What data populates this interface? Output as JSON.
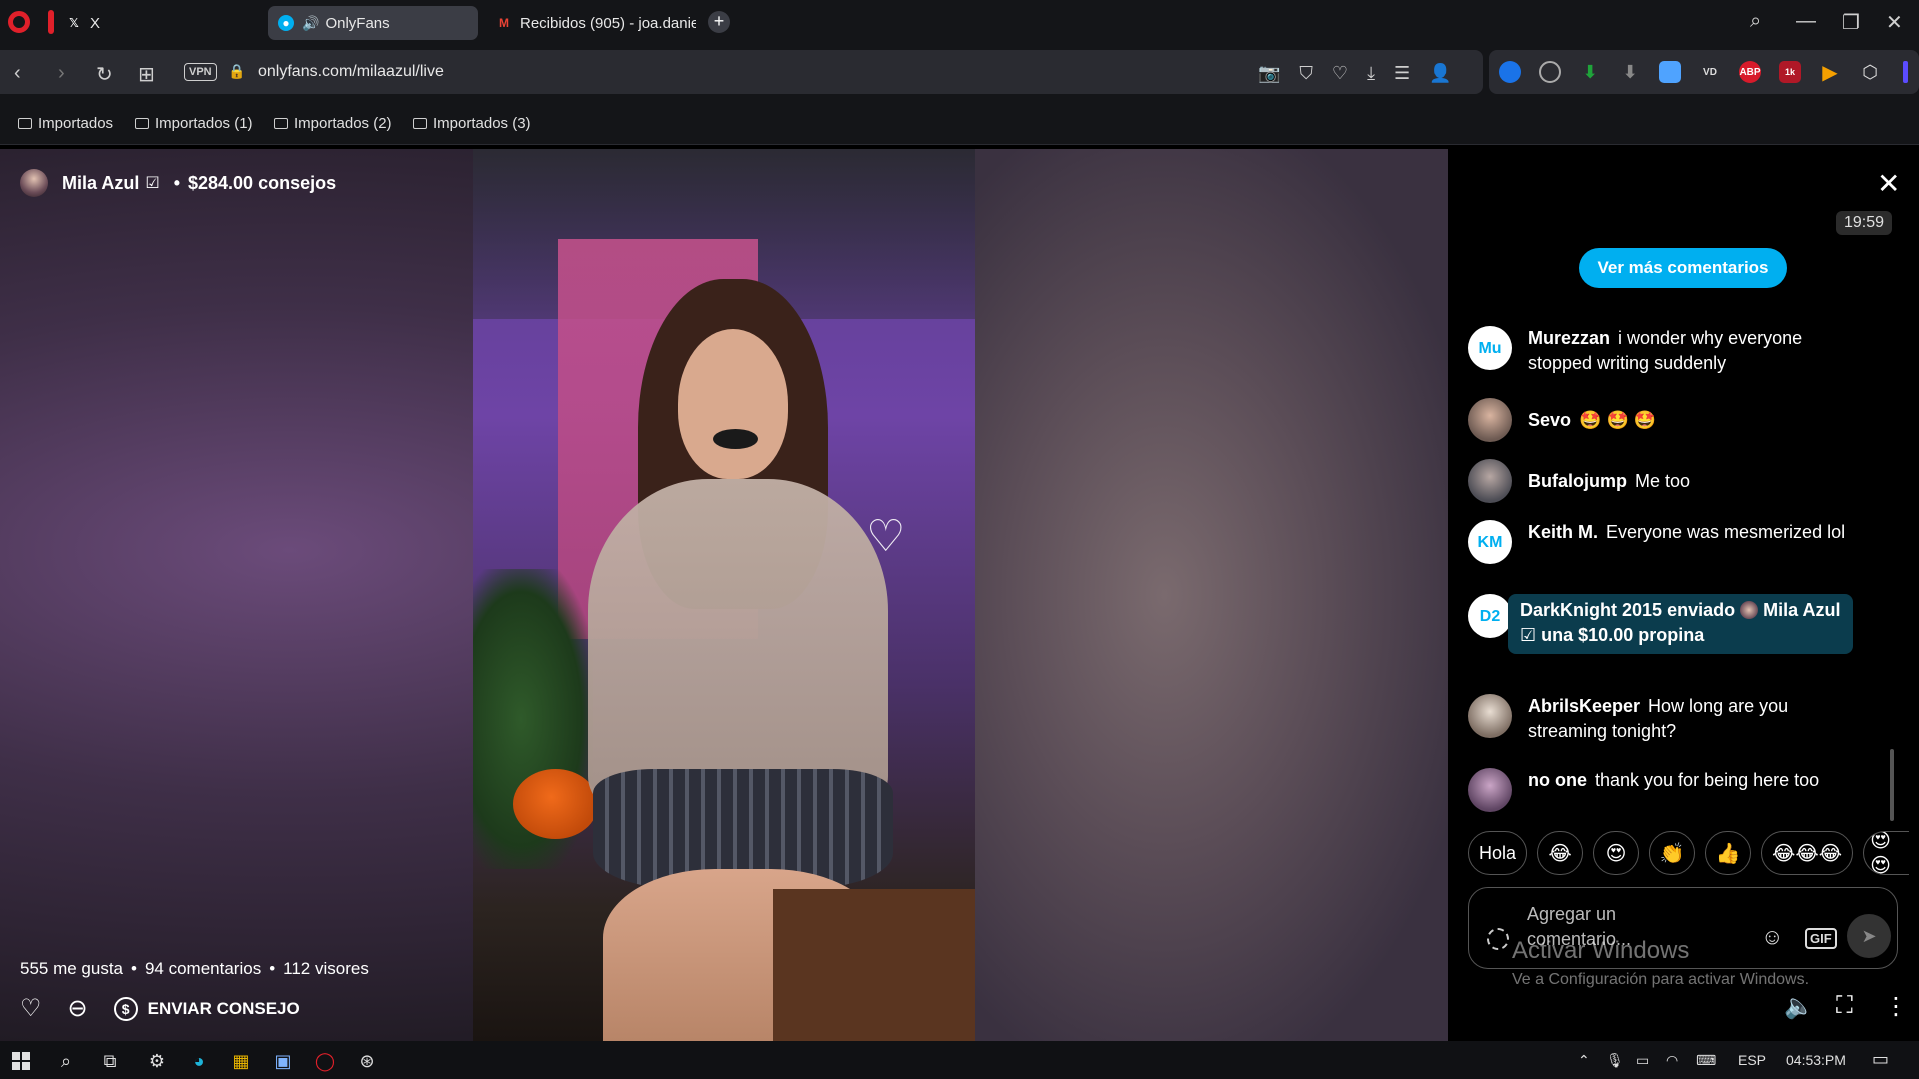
{
  "browser": {
    "tabs": [
      {
        "label": "X",
        "active": false
      },
      {
        "label": "OnlyFans",
        "active": true
      },
      {
        "label": "Recibidos (905) - joa.danie",
        "active": false
      }
    ],
    "url": "onlyfans.com/milaazul/live",
    "vpn_label": "VPN",
    "bookmarks": [
      "Importados",
      "Importados (1)",
      "Importados (2)",
      "Importados (3)"
    ],
    "extension_badge": "1k"
  },
  "stream": {
    "streamer_name": "Mila Azul",
    "tips_total": "$284.00 consejos",
    "stats": {
      "likes": "555 me gusta",
      "comments": "94 comentarios",
      "viewers": "112 visores"
    },
    "send_tip_label": "ENVIAR CONSEJO"
  },
  "chat": {
    "timer": "19:59",
    "see_more_label": "Ver más comentarios",
    "messages": [
      {
        "initials": "Mu",
        "name": "Murezzan",
        "text": "i wonder why everyone stopped writing suddenly"
      },
      {
        "initials": "",
        "name": "Sevo",
        "text": "🤩 🤩 🤩"
      },
      {
        "initials": "",
        "name": "Bufalojump",
        "text": "Me too"
      },
      {
        "initials": "KM",
        "name": "Keith M.",
        "text": "Everyone was mesmerized lol"
      },
      {
        "initials": "D2",
        "name": "DarkKnight 2015",
        "tip_sent": "enviado",
        "recipient": "Mila Azul",
        "tip_text": "una $10.00 propina"
      },
      {
        "initials": "",
        "name": "AbrilsKeeper",
        "text": "How long are you streaming tonight?"
      },
      {
        "initials": "",
        "name": "no one",
        "text": "thank you for being here too"
      }
    ],
    "quick_replies": [
      "Hola",
      "😂",
      "😍",
      "👏",
      "👍",
      "😂😂😂",
      "😍😍"
    ],
    "comment_placeholder": "Agregar un comentario...",
    "gif_label": "GIF",
    "windows_watermark": "Activar Windows",
    "windows_watermark_sub": "Ve a Configuración para activar Windows."
  },
  "taskbar": {
    "language": "ESP",
    "time": "04:53:PM"
  }
}
